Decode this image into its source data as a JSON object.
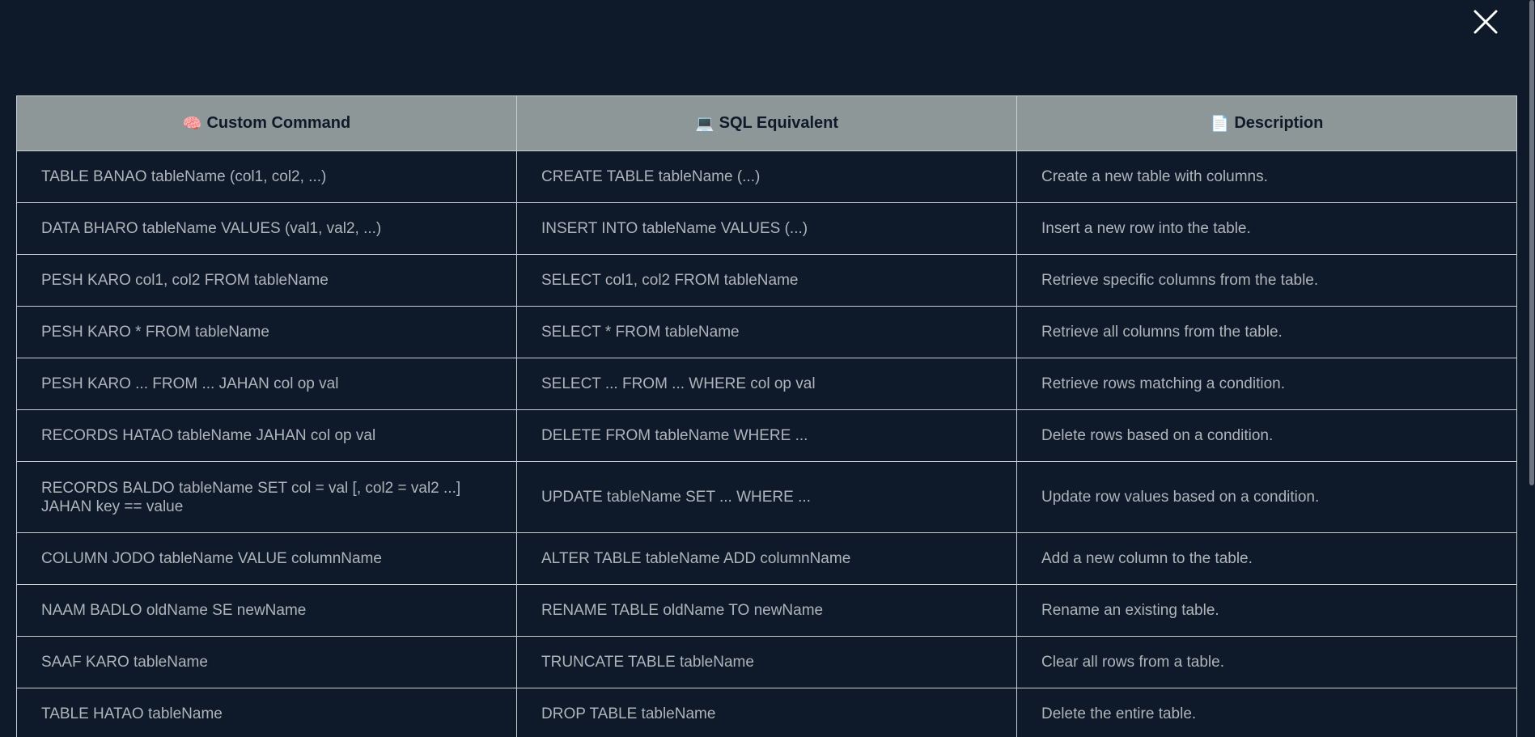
{
  "modal": {
    "close_label": "close"
  },
  "table": {
    "headers": [
      {
        "icon": "🧠",
        "label": "Custom Command"
      },
      {
        "icon": "💻",
        "label": "SQL Equivalent"
      },
      {
        "icon": "📄",
        "label": "Description"
      }
    ],
    "rows": [
      {
        "command": "TABLE BANAO tableName (col1, col2, ...)",
        "sql": "CREATE TABLE tableName (...)",
        "description": "Create a new table with columns."
      },
      {
        "command": "DATA BHARO tableName VALUES (val1, val2, ...)",
        "sql": "INSERT INTO tableName VALUES (...)",
        "description": "Insert a new row into the table."
      },
      {
        "command": "PESH KARO col1, col2 FROM tableName",
        "sql": "SELECT col1, col2 FROM tableName",
        "description": "Retrieve specific columns from the table."
      },
      {
        "command": "PESH KARO * FROM tableName",
        "sql": "SELECT * FROM tableName",
        "description": "Retrieve all columns from the table."
      },
      {
        "command": "PESH KARO ... FROM ... JAHAN col op val",
        "sql": "SELECT ... FROM ... WHERE col op val",
        "description": "Retrieve rows matching a condition."
      },
      {
        "command": "RECORDS HATAO tableName JAHAN col op val",
        "sql": "DELETE FROM tableName WHERE ...",
        "description": "Delete rows based on a condition."
      },
      {
        "command": "RECORDS BALDO tableName SET col = val [, col2 = val2 ...] JAHAN key == value",
        "sql": "UPDATE tableName SET ... WHERE ...",
        "description": "Update row values based on a condition."
      },
      {
        "command": "COLUMN JODO tableName VALUE columnName",
        "sql": "ALTER TABLE tableName ADD columnName",
        "description": "Add a new column to the table."
      },
      {
        "command": "NAAM BADLO oldName SE newName",
        "sql": "RENAME TABLE oldName TO newName",
        "description": "Rename an existing table."
      },
      {
        "command": "SAAF KARO tableName",
        "sql": "TRUNCATE TABLE tableName",
        "description": "Clear all rows from a table."
      },
      {
        "command": "TABLE HATAO tableName",
        "sql": "DROP TABLE tableName",
        "description": "Delete the entire table."
      }
    ]
  },
  "colors": {
    "background": "#0e1a2a",
    "header_bg": "#8d9798",
    "text": "#aeb4ba",
    "border": "#c9ced3"
  }
}
